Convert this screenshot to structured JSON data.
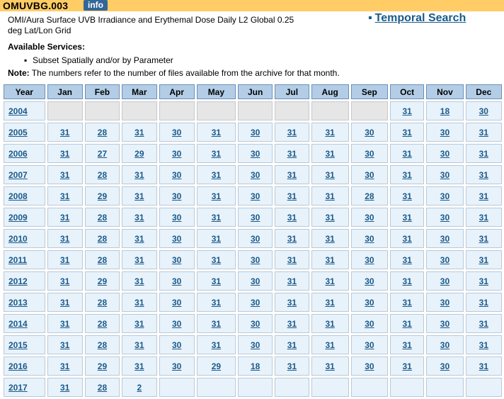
{
  "header": {
    "product_id": "OMUVBG.003",
    "info_label": "info",
    "description": "OMI/Aura Surface UVB Irradiance and Erythemal Dose Daily L2 Global 0.25 deg Lat/Lon Grid",
    "temporal_search": "Temporal Search",
    "temporal_bullet": "▪"
  },
  "services": {
    "heading": "Available Services:",
    "items": [
      "Subset Spatially and/or by Parameter"
    ],
    "bullet": "▪"
  },
  "note": {
    "label": "Note:",
    "text": " The numbers refer to the number of files available from the archive for that month."
  },
  "table": {
    "columns": [
      "Year",
      "Jan",
      "Feb",
      "Mar",
      "Apr",
      "May",
      "Jun",
      "Jul",
      "Aug",
      "Sep",
      "Oct",
      "Nov",
      "Dec"
    ],
    "rows": [
      {
        "year": "2004",
        "months": [
          "",
          "",
          "",
          "",
          "",
          "",
          "",
          "",
          "",
          "31",
          "18",
          "30"
        ]
      },
      {
        "year": "2005",
        "months": [
          "31",
          "28",
          "31",
          "30",
          "31",
          "30",
          "31",
          "31",
          "30",
          "31",
          "30",
          "31"
        ]
      },
      {
        "year": "2006",
        "months": [
          "31",
          "27",
          "29",
          "30",
          "31",
          "30",
          "31",
          "31",
          "30",
          "31",
          "30",
          "31"
        ]
      },
      {
        "year": "2007",
        "months": [
          "31",
          "28",
          "31",
          "30",
          "31",
          "30",
          "31",
          "31",
          "30",
          "31",
          "30",
          "31"
        ]
      },
      {
        "year": "2008",
        "months": [
          "31",
          "29",
          "31",
          "30",
          "31",
          "30",
          "31",
          "31",
          "28",
          "31",
          "30",
          "31"
        ]
      },
      {
        "year": "2009",
        "months": [
          "31",
          "28",
          "31",
          "30",
          "31",
          "30",
          "31",
          "31",
          "30",
          "31",
          "30",
          "31"
        ]
      },
      {
        "year": "2010",
        "months": [
          "31",
          "28",
          "31",
          "30",
          "31",
          "30",
          "31",
          "31",
          "30",
          "31",
          "30",
          "31"
        ]
      },
      {
        "year": "2011",
        "months": [
          "31",
          "28",
          "31",
          "30",
          "31",
          "30",
          "31",
          "31",
          "30",
          "31",
          "30",
          "31"
        ]
      },
      {
        "year": "2012",
        "months": [
          "31",
          "29",
          "31",
          "30",
          "31",
          "30",
          "31",
          "31",
          "30",
          "31",
          "30",
          "31"
        ]
      },
      {
        "year": "2013",
        "months": [
          "31",
          "28",
          "31",
          "30",
          "31",
          "30",
          "31",
          "31",
          "30",
          "31",
          "30",
          "31"
        ]
      },
      {
        "year": "2014",
        "months": [
          "31",
          "28",
          "31",
          "30",
          "31",
          "30",
          "31",
          "31",
          "30",
          "31",
          "30",
          "31"
        ]
      },
      {
        "year": "2015",
        "months": [
          "31",
          "28",
          "31",
          "30",
          "31",
          "30",
          "31",
          "31",
          "30",
          "31",
          "30",
          "31"
        ]
      },
      {
        "year": "2016",
        "months": [
          "31",
          "29",
          "31",
          "30",
          "29",
          "18",
          "31",
          "31",
          "30",
          "31",
          "30",
          "31"
        ]
      },
      {
        "year": "2017",
        "months": [
          "31",
          "28",
          "2",
          "",
          "",
          "",
          "",
          "",
          "",
          "",
          "",
          ""
        ]
      }
    ]
  },
  "colors": {
    "title_bar": "#ffcc66",
    "info_badge": "#336699",
    "header_cell": "#b3cde6",
    "data_cell": "#e8f2fb",
    "empty_cell": "#e6e6e6",
    "link": "#1a5a8a"
  }
}
